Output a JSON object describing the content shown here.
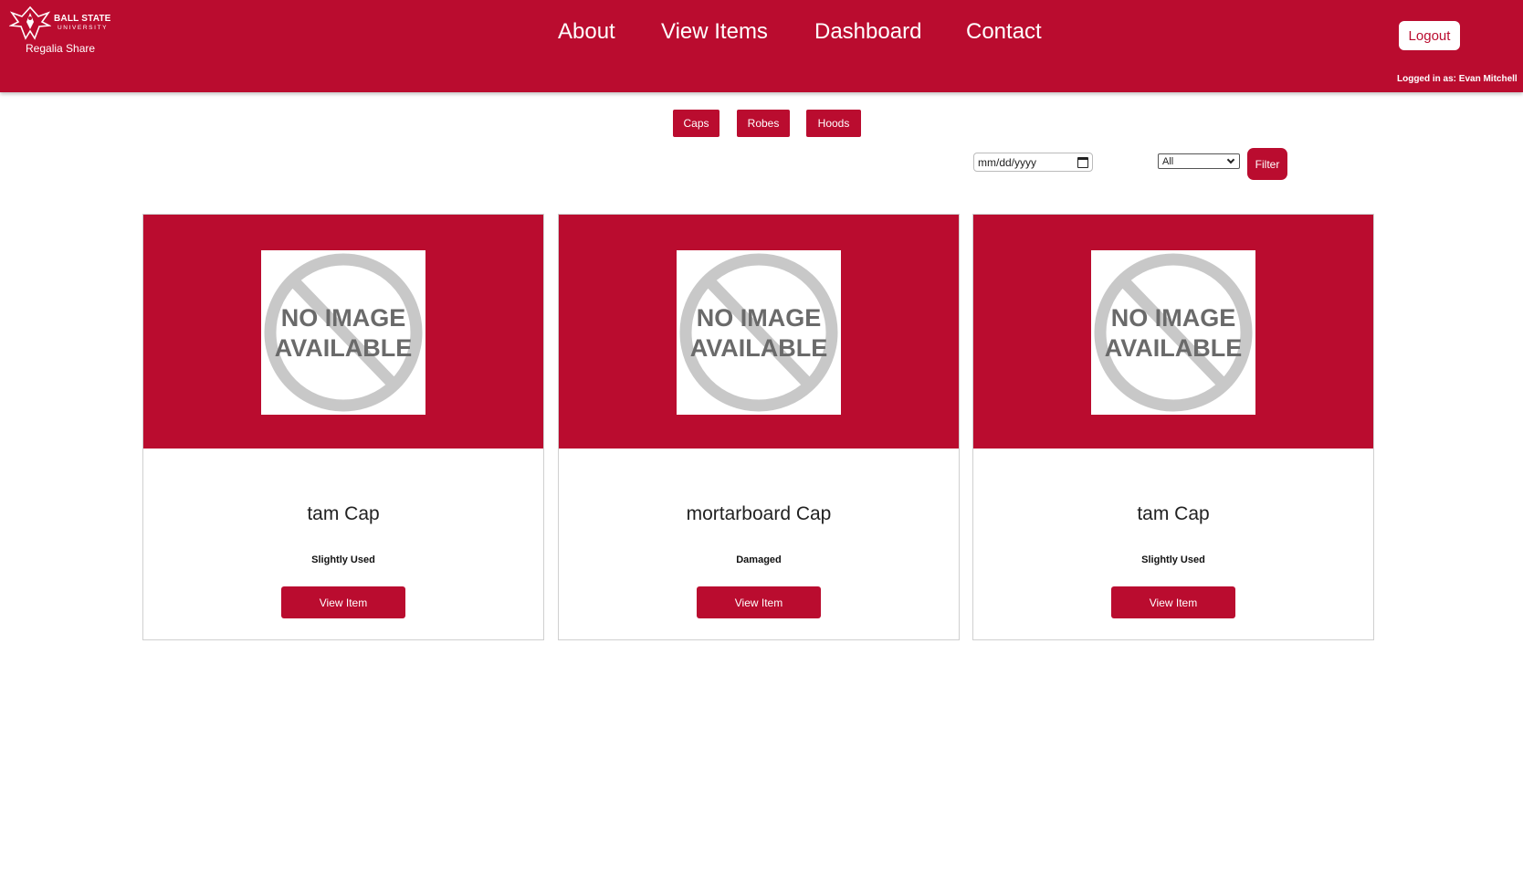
{
  "brand": {
    "university_line1": "BALL STATE",
    "university_line2": "UNIVERSITY",
    "app_name": "Regalia Share",
    "primary_color": "#ba0c2f"
  },
  "nav": {
    "items": [
      {
        "label": "About"
      },
      {
        "label": "View Items"
      },
      {
        "label": "Dashboard"
      },
      {
        "label": "Contact"
      }
    ]
  },
  "header": {
    "logout_label": "Logout",
    "logged_in_text": "Logged in as: Evan Mitchell"
  },
  "categories": [
    {
      "label": "Caps"
    },
    {
      "label": "Robes"
    },
    {
      "label": "Hoods"
    }
  ],
  "filters": {
    "date_placeholder": "mm/dd/yyyy",
    "select_value": "All",
    "filter_label": "Filter"
  },
  "no_image": {
    "line1": "NO IMAGE",
    "line2": "AVAILABLE"
  },
  "items": [
    {
      "title": "tam Cap",
      "condition": "Slightly Used",
      "button_label": "View Item"
    },
    {
      "title": "mortarboard Cap",
      "condition": "Damaged",
      "button_label": "View Item"
    },
    {
      "title": "tam Cap",
      "condition": "Slightly Used",
      "button_label": "View Item"
    }
  ]
}
